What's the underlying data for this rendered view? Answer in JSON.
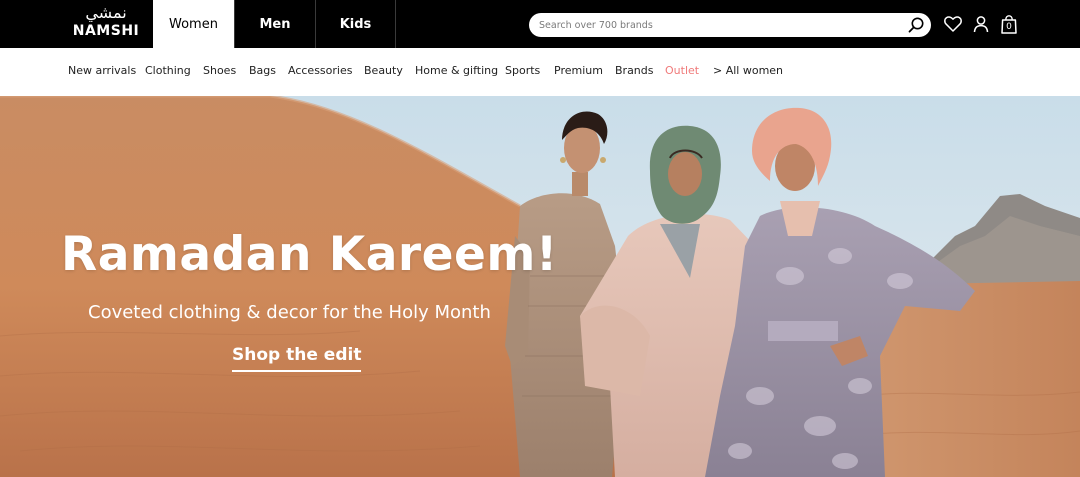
{
  "brand": {
    "logo_arabic": "نمشي",
    "logo_text": "NAMSHI"
  },
  "departments": [
    {
      "label": "Women",
      "active": true
    },
    {
      "label": "Men",
      "active": false
    },
    {
      "label": "Kids",
      "active": false
    }
  ],
  "search": {
    "placeholder": "Search over 700 brands",
    "value": ""
  },
  "header_icons": [
    "heart-icon",
    "user-icon",
    "shopping-bag-icon"
  ],
  "cart": {
    "count": "0"
  },
  "categories": [
    {
      "label": "New arrivals"
    },
    {
      "label": "Clothing"
    },
    {
      "label": "Shoes"
    },
    {
      "label": "Bags"
    },
    {
      "label": "Accessories"
    },
    {
      "label": "Beauty"
    },
    {
      "label": "Home & gifting"
    },
    {
      "label": "Sports"
    },
    {
      "label": "Premium"
    },
    {
      "label": "Brands"
    },
    {
      "label": "Outlet",
      "highlight": true
    },
    {
      "label": "> All women"
    }
  ],
  "hero": {
    "headline": "Ramadan Kareem!",
    "subheading": "Coveted clothing & decor for the Holy Month",
    "cta_label": "Shop the edit"
  },
  "colors": {
    "topbar": "#000000",
    "outlet": "#f07a7a",
    "sand": "#c8865a",
    "sky": "#d9e6ee"
  }
}
